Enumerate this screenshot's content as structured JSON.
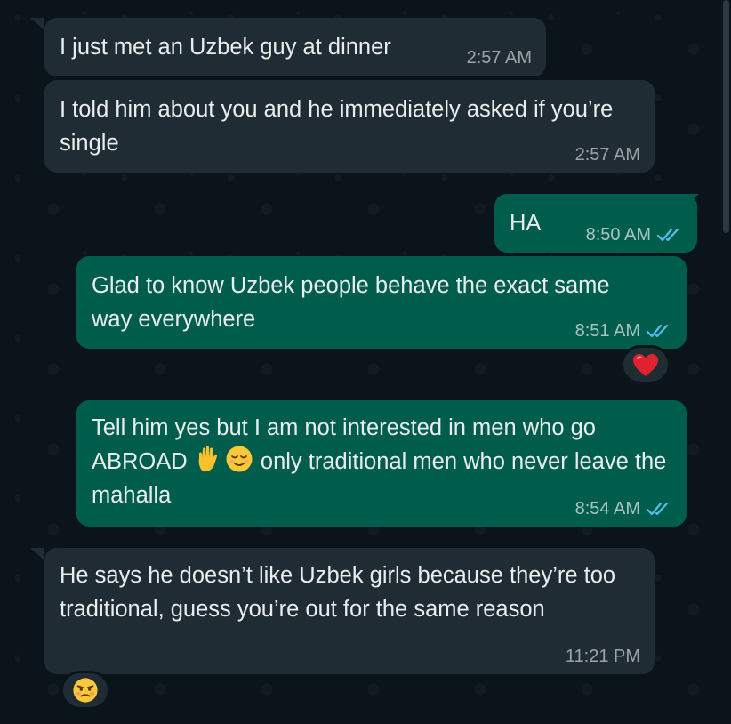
{
  "messages": [
    {
      "direction": "incoming",
      "text": "I just met an Uzbek guy at dinner",
      "time": "2:57 AM"
    },
    {
      "direction": "incoming",
      "text": "I told him about you and he immediately asked if you’re single",
      "time": "2:57 AM"
    },
    {
      "direction": "outgoing",
      "text": "HA",
      "time": "8:50 AM",
      "status": "read"
    },
    {
      "direction": "outgoing",
      "text": "Glad to know Uzbek people behave the exact same way everywhere",
      "time": "8:51 AM",
      "status": "read",
      "reaction": "red-heart"
    },
    {
      "direction": "outgoing",
      "text_before_emoji": "Tell him yes but I am not interested in men who go ABROAD",
      "emojis": [
        "raised-hand",
        "relieved-face"
      ],
      "text_after_emoji": "only traditional men who never leave the mahalla",
      "time": "8:54 AM",
      "status": "read"
    },
    {
      "direction": "incoming",
      "text": "He says he doesn’t like Uzbek girls because they’re too traditional, guess you’re out for the same reason",
      "time": "11:21 PM",
      "reaction": "unamused-face"
    }
  ],
  "colors": {
    "background": "#0b141a",
    "incoming_bubble": "#202c33",
    "outgoing_bubble": "#005c4b",
    "text": "#e9edef",
    "read_ticks": "#53bdeb"
  },
  "icons": [
    "double-check-read-icon",
    "heart-icon",
    "raised-hand-icon",
    "relieved-face-icon",
    "unamused-face-icon"
  ]
}
